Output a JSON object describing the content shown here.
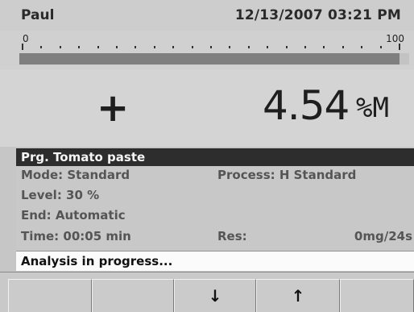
{
  "status_bar": {
    "user": "Paul",
    "datetime": "12/13/2007 03:21 PM"
  },
  "scale": {
    "min_label": "0",
    "max_label": "100",
    "progress_fraction": 0.975
  },
  "reading": {
    "sign": "+",
    "value": "4.54",
    "unit": "%M"
  },
  "program": {
    "title": "Prg. Tomato paste",
    "mode": "Mode: Standard",
    "process": "Process: H Standard",
    "level": "Level:  30 %",
    "end": "End: Automatic",
    "time": "Time: 00:05 min",
    "res_label": "Res:",
    "res_value": "0mg/24s"
  },
  "status_message": "Analysis in progress...",
  "softkeys": [
    {
      "name": "softkey-1",
      "label": ""
    },
    {
      "name": "softkey-2",
      "label": ""
    },
    {
      "name": "softkey-down",
      "label": "↓",
      "icon": "arrow-down-icon"
    },
    {
      "name": "softkey-up",
      "label": "↑",
      "icon": "arrow-up-icon"
    },
    {
      "name": "softkey-5",
      "label": ""
    }
  ]
}
